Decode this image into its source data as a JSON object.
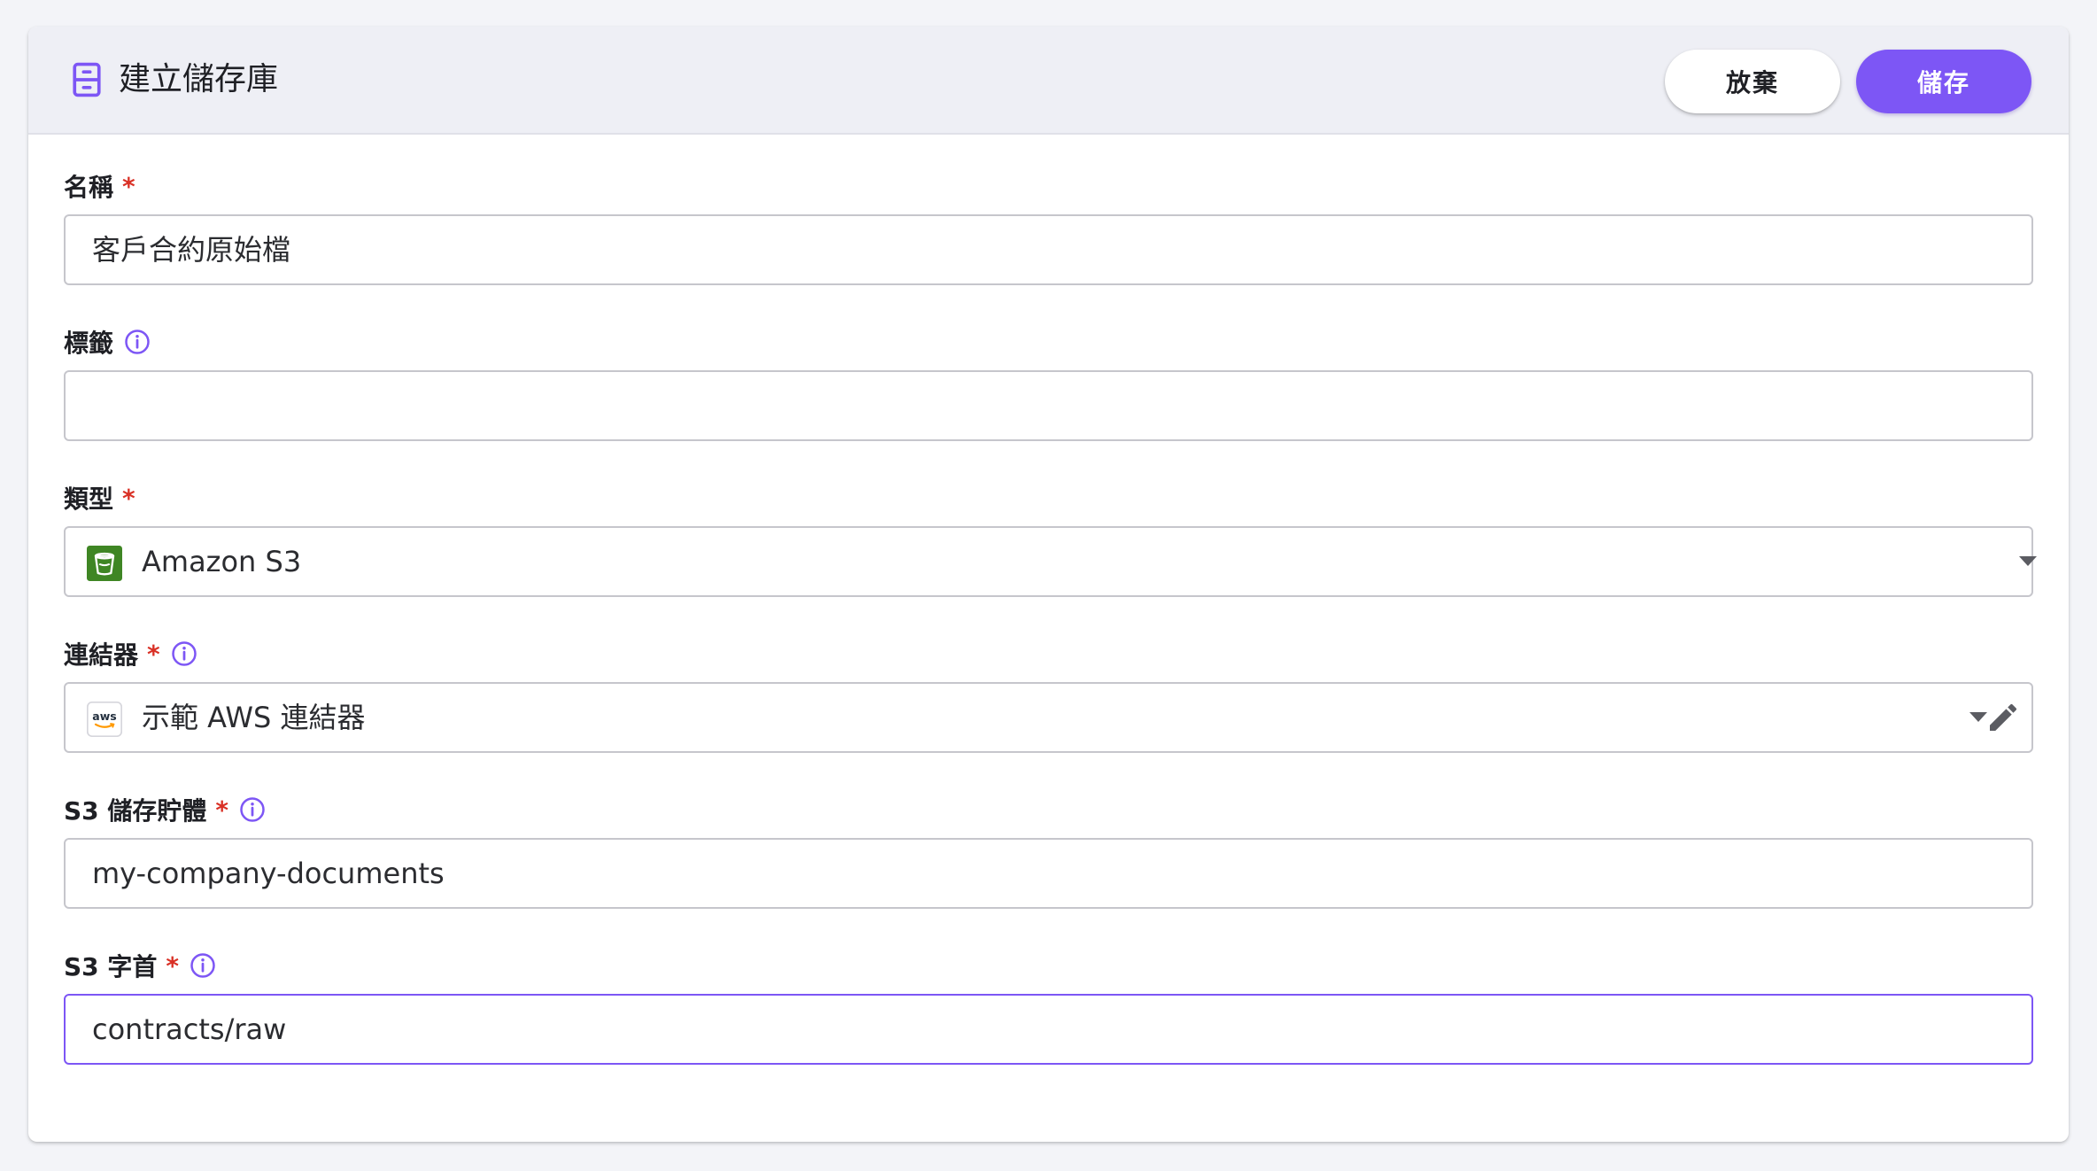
{
  "header": {
    "title": "建立儲存庫",
    "discard_label": "放棄",
    "save_label": "儲存",
    "icon": "archive-icon"
  },
  "fields": {
    "name": {
      "label": "名稱",
      "required_mark": "*",
      "value": "客戶合約原始檔"
    },
    "tags": {
      "label": "標籤",
      "value": "",
      "icon": "info-icon"
    },
    "type": {
      "label": "類型",
      "required_mark": "*",
      "value": "Amazon S3",
      "icon": "s3-bucket-icon"
    },
    "connector": {
      "label": "連結器",
      "required_mark": "*",
      "value": "示範 AWS 連結器",
      "icon": "aws-logo-icon"
    },
    "bucket": {
      "label": "S3 儲存貯體",
      "required_mark": "*",
      "value": "my-company-documents"
    },
    "prefix": {
      "label": "S3 字首",
      "required_mark": "*",
      "value": "contracts/raw"
    }
  },
  "colors": {
    "accent": "#7d56f5",
    "required": "#d93025",
    "header_bg": "#eeeff5",
    "page_bg": "#f3f4f8",
    "s3_green": "#3f8624"
  }
}
